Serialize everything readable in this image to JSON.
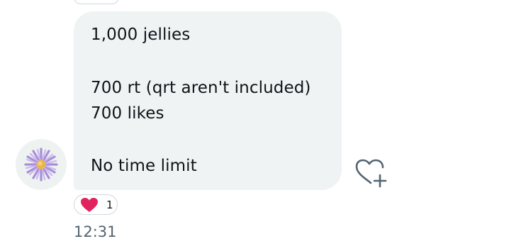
{
  "message": {
    "lines": [
      "1,000 jellies",
      "700 rt (qrt aren't included)",
      "700 likes",
      "No time limit"
    ]
  },
  "reaction": {
    "emoji_icon": "red-heart-icon",
    "count": "1"
  },
  "timestamp": "12:31",
  "icons": {
    "add_reaction": "heart-plus-icon",
    "avatar": "purple-aster-flower"
  },
  "colors": {
    "bubble_bg": "#eff3f4",
    "heart_red": "#e0245e",
    "timestamp": "#536471"
  }
}
